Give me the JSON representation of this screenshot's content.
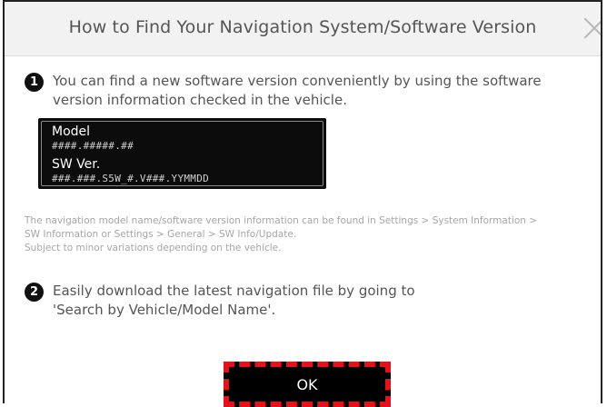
{
  "dialog": {
    "title": "How to Find Your Navigation System/Software Version"
  },
  "steps": [
    {
      "number": "1",
      "text": "You can find a new software version conveniently by using the software version information checked in the vehicle."
    },
    {
      "number": "2",
      "text": "Easily download the latest navigation file by going to 'Search by Vehicle/Model Name'."
    }
  ],
  "info_card": {
    "model_label": "Model",
    "model_value": "####.#####.##",
    "sw_label": "SW Ver.",
    "sw_value": "###.###.S5W_#.V###.YYMMDD"
  },
  "note": {
    "line1": "The navigation model name/software version information can be found in Settings > System Information >",
    "line2": "SW Information or Settings > General > SW Info/Update.",
    "line3": "Subject to minor variations depending on the vehicle."
  },
  "buttons": {
    "ok_label": "OK"
  },
  "colors": {
    "header_bg": "#f2f2f2",
    "button_bg": "#000000",
    "highlight": "#e8111b"
  }
}
